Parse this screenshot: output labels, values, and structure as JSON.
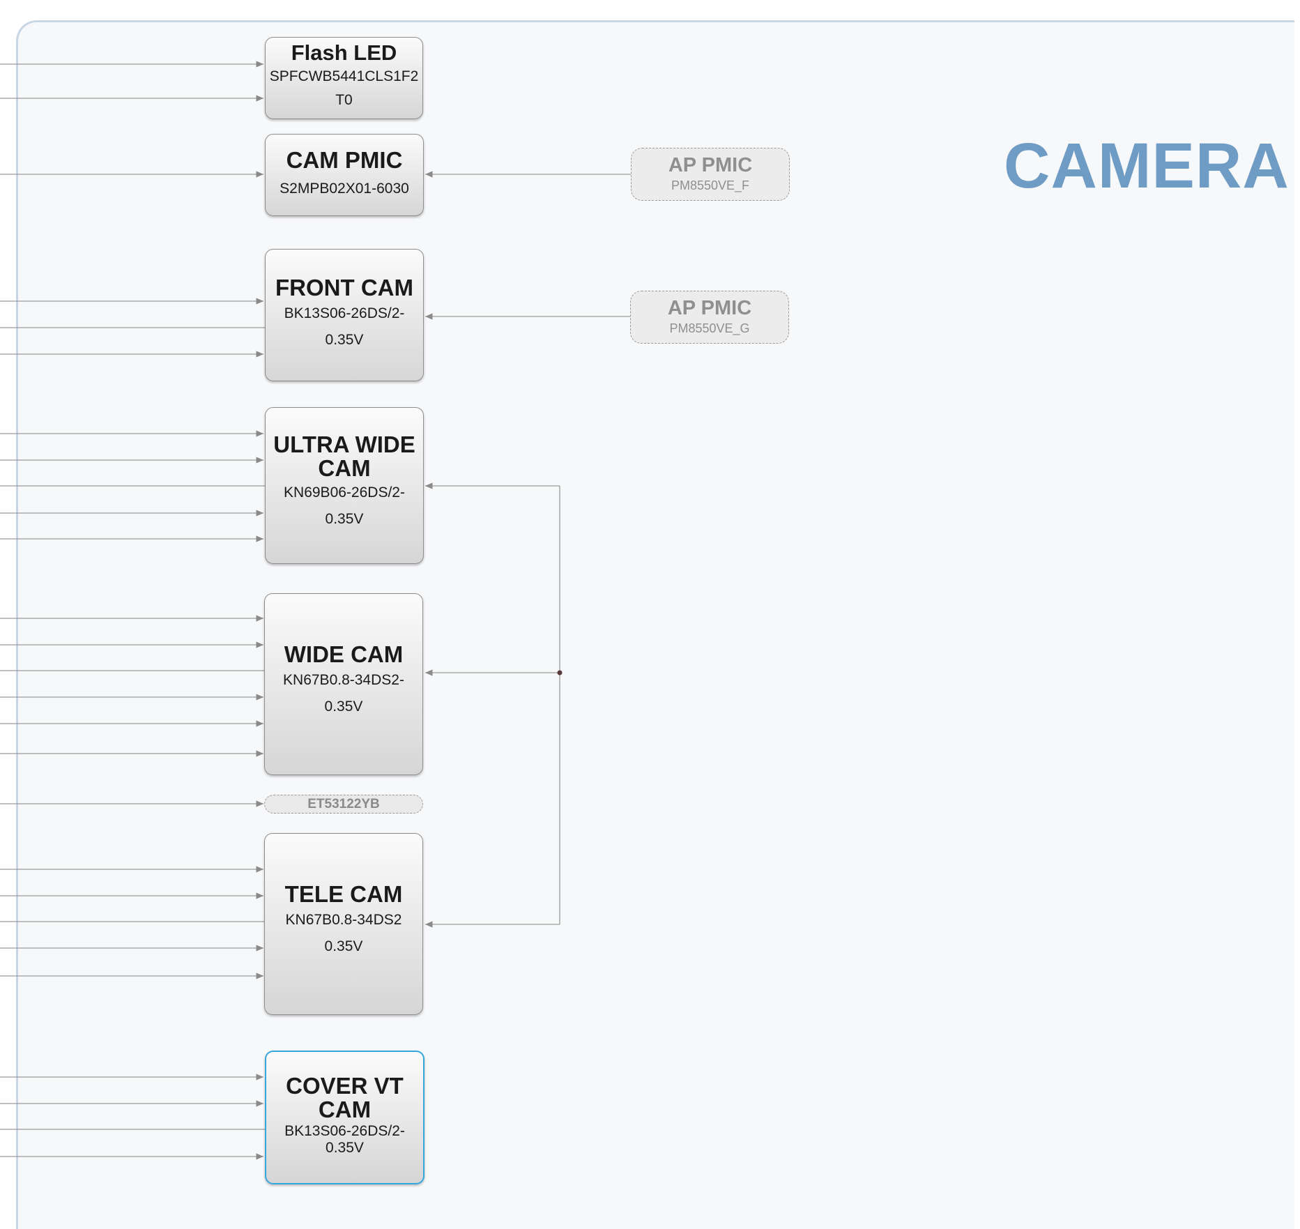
{
  "section": {
    "title": "CAMERA"
  },
  "blocks": {
    "flash_led": {
      "title": "Flash LED",
      "part_line1": "SPFCWB5441CLS1F2",
      "part_line2": "T0"
    },
    "cam_pmic": {
      "title": "CAM PMIC",
      "part_line1": "S2MPB02X01-6030"
    },
    "front_cam": {
      "title": "FRONT CAM",
      "part_line1": "BK13S06-26DS/2-",
      "part_line2": "0.35V"
    },
    "ultra_wide": {
      "title_line1": "ULTRA WIDE",
      "title_line2": "CAM",
      "part_line1": "KN69B06-26DS/2-",
      "part_line2": "0.35V"
    },
    "wide_cam": {
      "title": "WIDE CAM",
      "part_line1": "KN67B0.8-34DS2-",
      "part_line2": "0.35V"
    },
    "tele_cam": {
      "title": "TELE CAM",
      "part_line1": "KN67B0.8-34DS2",
      "part_line2": "0.35V"
    },
    "cover_vt": {
      "title_line1": "COVER VT",
      "title_line2": "CAM",
      "part_line1": "BK13S06-26DS/2-",
      "part_line2": "0.35V"
    }
  },
  "external": {
    "ap_pmic_f": {
      "title": "AP PMIC",
      "part": "PM8550VE_F"
    },
    "ap_pmic_g": {
      "title": "AP PMIC",
      "part": "PM8550VE_G"
    },
    "et_chip": {
      "label": "ET53122YB"
    }
  },
  "colors": {
    "accent": "#6f9cc4",
    "highlight_border": "#35a7dc",
    "wire": "#9a9a9a"
  }
}
